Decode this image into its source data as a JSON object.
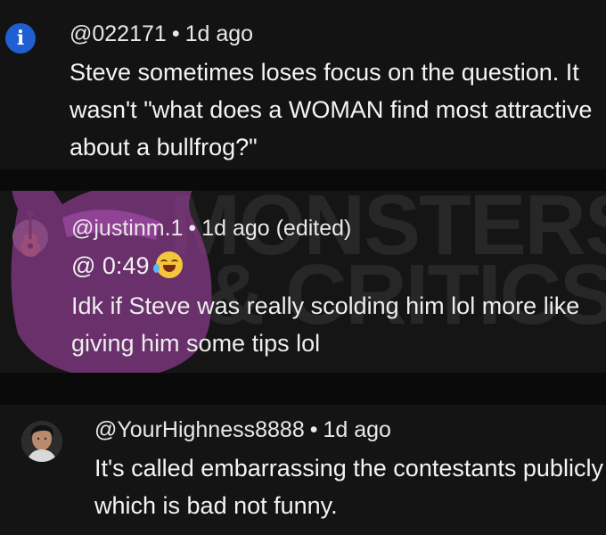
{
  "comments": [
    {
      "handle": "@022171",
      "separator": "•",
      "time": "1d ago",
      "text": "Steve sometimes loses focus on the question. It wasn't \"what does a WOMAN find most attractive about a bullfrog?\"",
      "badge_icon": "info-icon",
      "badge_glyph": "i",
      "badge_color": "#1f5fd1"
    },
    {
      "handle": "@justinm.1",
      "separator": "•",
      "time": "1d ago (edited)",
      "timestamp_link": "@ 0:49",
      "emoji": "laughing-tears-emoji",
      "text": "Idk if Steve was really scolding him lol more like giving him some tips lol",
      "avatar_icon": "guitar-icon",
      "overlay_icon": "purple-monster-mascot-icon",
      "overlay_color": "#8a3c8f",
      "watermark_text": "MONSTERS & CRITICS"
    },
    {
      "handle": "@YourHighness8888",
      "separator": "•",
      "time": "1d ago",
      "text": "It's called embarrassing the contestants publicly which is bad not funny.",
      "avatar_icon": "user-avatar"
    }
  ]
}
